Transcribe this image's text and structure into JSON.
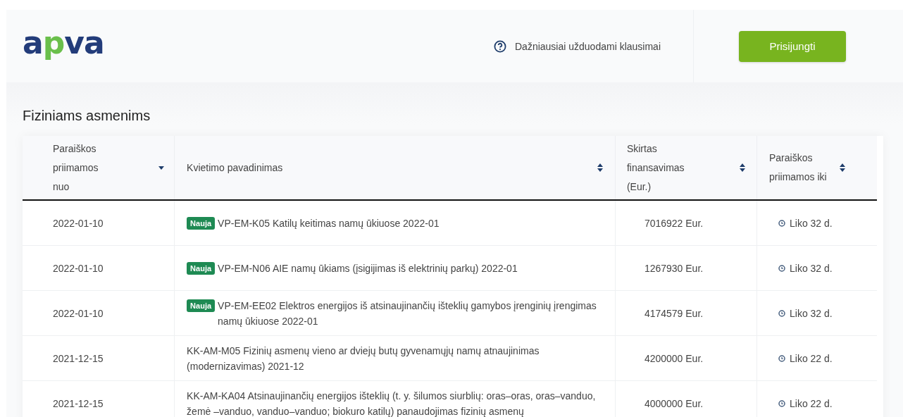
{
  "header": {
    "logo": {
      "parts": [
        {
          "text": "a",
          "kind": "dark"
        },
        {
          "text": "p",
          "kind": "accent"
        },
        {
          "text": "va",
          "kind": "dark"
        }
      ]
    },
    "faq_link": "Dažniausiai užduodami klausimai",
    "login_button": "Prisijungti"
  },
  "section_title": "Fiziniams asmenims",
  "table": {
    "columns": [
      {
        "label": "Paraiškos priimamos nuo",
        "sorted": true
      },
      {
        "label": "Kvietimo pavadinimas",
        "sorted": false
      },
      {
        "label": "Skirtas finansavimas (Eur.)",
        "sorted": false
      },
      {
        "label": "Paraiškos priimamos iki",
        "sorted": false
      }
    ],
    "rows": [
      {
        "date_from": "2022-01-10",
        "badge": "Nauja",
        "name": "VP-EM-K05 Katilų keitimas namų ūkiuose 2022-01",
        "funding": "7016922 Eur.",
        "deadline": "Liko 32 d."
      },
      {
        "date_from": "2022-01-10",
        "badge": "Nauja",
        "name": "VP-EM-N06 AIE namų ūkiams (įsigijimas iš elektrinių parkų) 2022-01",
        "funding": "1267930 Eur.",
        "deadline": "Liko 32 d."
      },
      {
        "date_from": "2022-01-10",
        "badge": "Nauja",
        "name": "VP-EM-EE02 Elektros energijos iš atsinaujinančių išteklių gamybos įrenginių įrengimas namų ūkiuose 2022-01",
        "funding": "4174579 Eur.",
        "deadline": "Liko 32 d."
      },
      {
        "date_from": "2021-12-15",
        "name": "KK-AM-M05 Fizinių asmenų vieno ar dviejų butų gyvenamųjų namų atnaujinimas (modernizavimas) 2021-12",
        "funding": "4200000 Eur.",
        "deadline": "Liko 22 d."
      },
      {
        "date_from": "2021-12-15",
        "name": "KK-AM-KA04 Atsinaujinančių energijos išteklių (t. y. šilumos siurblių: oras–oras, oras–vanduo, žemė –vanduo, vanduo–vanduo; biokuro katilų) panaudojimas fizinių asmenų",
        "funding": "4000000 Eur.",
        "deadline": "Liko 22 d."
      }
    ]
  }
}
